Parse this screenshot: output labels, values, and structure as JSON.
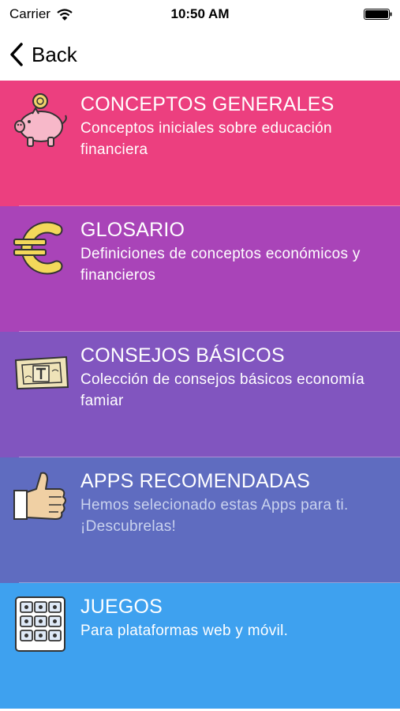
{
  "status_bar": {
    "carrier": "Carrier",
    "time": "10:50 AM"
  },
  "nav": {
    "back_label": "Back"
  },
  "menu": {
    "items": [
      {
        "title": "CONCEPTOS GENERALES",
        "description": "Conceptos iniciales sobre educación financiera",
        "color": "#ec3f7f",
        "icon": "piggy-bank-icon"
      },
      {
        "title": "GLOSARIO",
        "description": "Definiciones de conceptos económicos y financieros",
        "color": "#a944b8",
        "icon": "euro-icon"
      },
      {
        "title": "CONSEJOS BÁSICOS",
        "description": "Colección de consejos básicos economía famiar",
        "color": "#8155bf",
        "icon": "banknote-icon"
      },
      {
        "title": "APPS RECOMENDADAS",
        "description": "Hemos selecionado estas Apps para ti. ¡Descubrelas!",
        "color": "#5f6cc0",
        "icon": "thumbs-up-icon"
      },
      {
        "title": "JUEGOS",
        "description": "Para plataformas web y móvil.",
        "color": "#3ea1ef",
        "icon": "keypad-icon"
      }
    ]
  }
}
